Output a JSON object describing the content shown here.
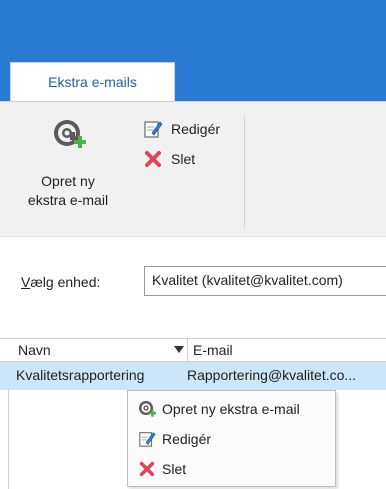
{
  "ribbon": {
    "tab_label": "Ekstra e-mails",
    "create_label_line1": "Opret ny",
    "create_label_line2": "ekstra e-mail",
    "edit_label": "Redigér",
    "delete_label": "Slet"
  },
  "unit": {
    "label_mnemonic": "V",
    "label_rest": "ælg enhed:",
    "value": "Kvalitet (kvalitet@kvalitet.com)"
  },
  "grid": {
    "columns": [
      "Navn",
      "E-mail"
    ],
    "rows": [
      {
        "name": "Kvalitetsrapportering",
        "email": "Rapportering@kvalitet.co..."
      }
    ]
  },
  "context_menu": {
    "items": [
      {
        "label": "Opret ny ekstra e-mail",
        "icon": "at-add-icon"
      },
      {
        "label": "Redigér",
        "icon": "edit-icon"
      },
      {
        "label": "Slet",
        "icon": "delete-icon"
      }
    ]
  },
  "colors": {
    "title_bar": "#2b7bd4",
    "selection": "#cde6f7",
    "delete_red": "#e0445a",
    "add_green": "#4caf50"
  }
}
